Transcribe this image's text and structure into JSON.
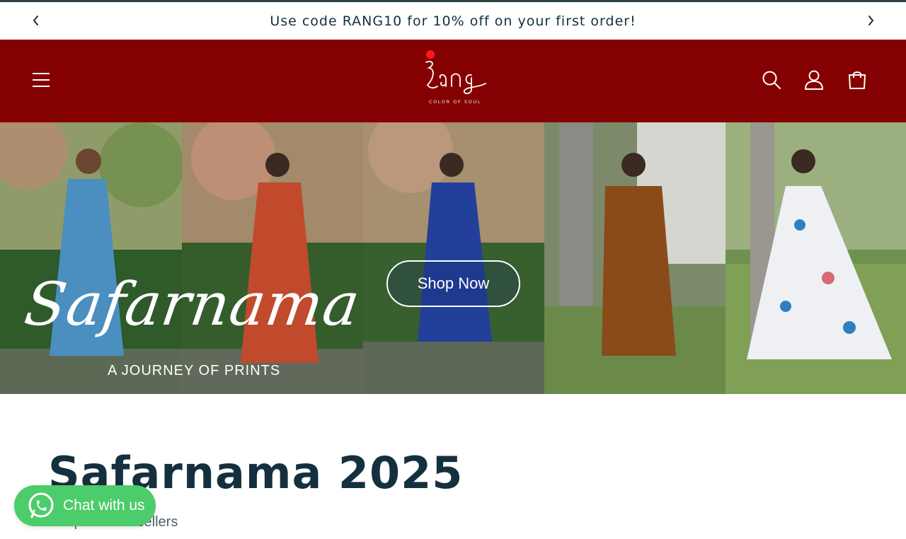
{
  "announcement": {
    "text": "Use code RANG10 for 10% off on your first order!"
  },
  "header": {
    "logo_text": "Rang",
    "logo_tagline": "COLOR OF SOUL",
    "brand_color": "#850000"
  },
  "hero": {
    "title": "Safarnama",
    "subtitle": "A JOURNEY OF PRINTS",
    "button_label": "Shop Now"
  },
  "collection": {
    "title": "Safarnama 2025",
    "subtitle": "Shop our bestsellers"
  },
  "chat": {
    "label": "Chat with us",
    "color": "#4ccc6a"
  }
}
